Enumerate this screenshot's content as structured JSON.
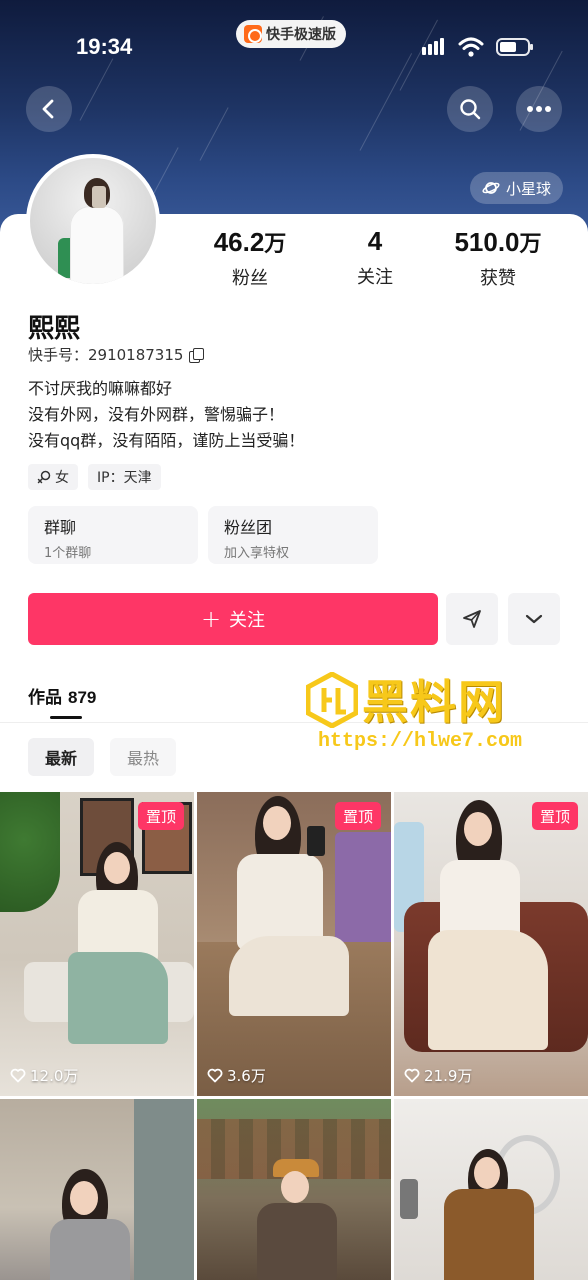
{
  "status_bar": {
    "time": "19:34",
    "app_pill": "快手极速版"
  },
  "header": {
    "planet_label": "小星球"
  },
  "stats": [
    {
      "num": "46.2",
      "unit": "万",
      "label": "粉丝"
    },
    {
      "num": "4",
      "unit": "",
      "label": "关注"
    },
    {
      "num": "510.0",
      "unit": "万",
      "label": "获赞"
    }
  ],
  "profile": {
    "name": "熙熙",
    "kuaishou_id": "快手号：2910187315",
    "bio_lines": [
      "不讨厌我的嘛嘛都好",
      "没有外网，没有外网群，警惕骗子！",
      "没有qq群，没有陌陌，谨防上当受骗！"
    ],
    "tags": [
      {
        "label": "女",
        "icon": "female-icon"
      },
      {
        "label": "IP：天津"
      }
    ]
  },
  "group_cards": [
    {
      "title": "群聊",
      "subtitle": "1个群聊"
    },
    {
      "title": "粉丝团",
      "subtitle": "加入享特权"
    }
  ],
  "actions": {
    "follow_label": "关注"
  },
  "works": {
    "tab_label": "作品",
    "count": "879"
  },
  "watermark": {
    "title": "黑料网",
    "url": "https://hlwe7.com"
  },
  "sort": {
    "newest": "最新",
    "hottest": "最热"
  },
  "grid": [
    {
      "pinned": "置顶",
      "likes": "12.0万"
    },
    {
      "pinned": "置顶",
      "likes": "3.6万"
    },
    {
      "pinned": "置顶",
      "likes": "21.9万"
    },
    {
      "pinned": "",
      "likes": ""
    },
    {
      "pinned": "",
      "likes": ""
    },
    {
      "pinned": "",
      "likes": ""
    }
  ],
  "colors": {
    "accent": "#fe3666",
    "watermark": "#f7c81a"
  }
}
